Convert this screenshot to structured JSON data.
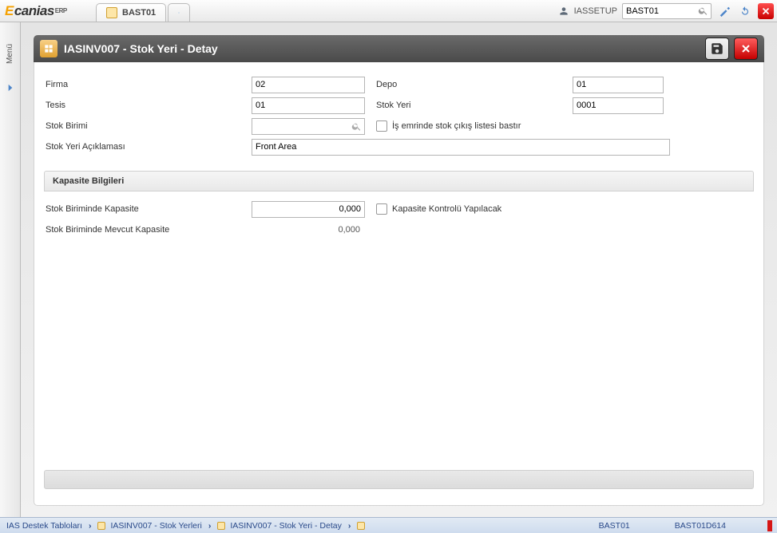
{
  "app": {
    "logo_main": "canias",
    "logo_sup": "ERP"
  },
  "tabs": {
    "active": "BAST01"
  },
  "user": {
    "name": "IASSETUP"
  },
  "search": {
    "value": "BAST01"
  },
  "sidemenu": {
    "label": "Menü"
  },
  "window": {
    "title": "IASINV007 - Stok Yeri - Detay"
  },
  "form": {
    "firma_label": "Firma",
    "firma_value": "02",
    "depo_label": "Depo",
    "depo_value": "01",
    "tesis_label": "Tesis",
    "tesis_value": "01",
    "stok_yeri_label": "Stok Yeri",
    "stok_yeri_value": "0001",
    "stok_birimi_label": "Stok Birimi",
    "stok_birimi_value": "",
    "is_emri_chk_label": "İş emrinde stok çıkış listesi bastır",
    "stok_yeri_aciklama_label": "Stok Yeri Açıklaması",
    "stok_yeri_aciklama_value": "Front Area"
  },
  "section": {
    "title": "Kapasite Bilgileri",
    "kapasite_label": "Stok Biriminde Kapasite",
    "kapasite_value": "0,000",
    "kapasite_kontrol_label": "Kapasite Kontrolü Yapılacak",
    "mevcut_label": "Stok Biriminde Mevcut Kapasite",
    "mevcut_value": "0,000"
  },
  "breadcrumbs": {
    "b1": "IAS Destek Tabloları",
    "b2": "IASINV007 - Stok Yerleri",
    "b3": "IASINV007 - Stok Yeri - Detay"
  },
  "status": {
    "s1": "BAST01",
    "s2": "BAST01D614"
  }
}
